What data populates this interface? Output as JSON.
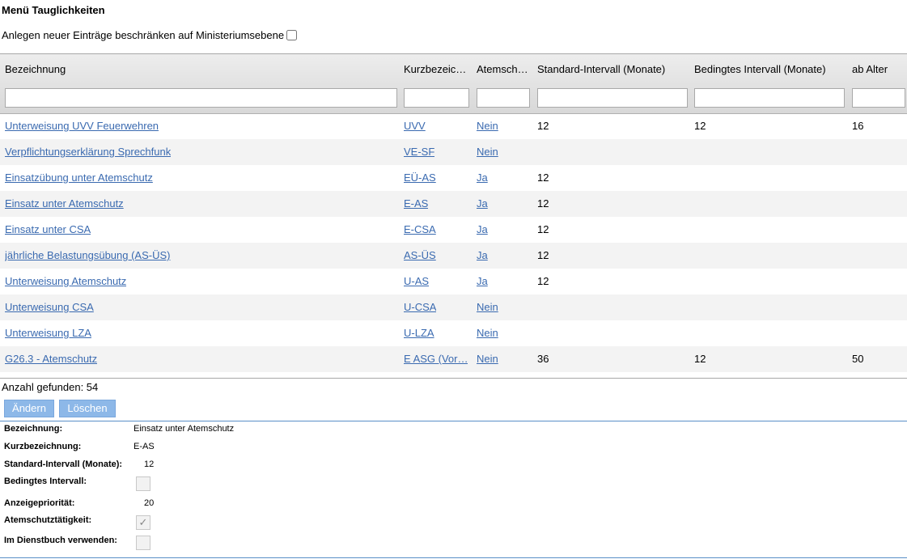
{
  "page_title": "Menü Tauglichkeiten",
  "restrict_label": "Anlegen neuer Einträge beschränken auf Ministeriumsebene",
  "columns": [
    "Bezeichnung",
    "Kurzbezeic…",
    "Atemsch…",
    "Standard-Intervall (Monate)",
    "Bedingtes Intervall (Monate)",
    "ab Alter"
  ],
  "rows": [
    {
      "bezeichnung": "Unterweisung UVV Feuerwehren",
      "kurz": "UVV",
      "atem": "Nein",
      "std": "12",
      "bed": "12",
      "alter": "16"
    },
    {
      "bezeichnung": "Verpflichtungserklärung Sprechfunk",
      "kurz": "VE-SF",
      "atem": "Nein",
      "std": "",
      "bed": "",
      "alter": ""
    },
    {
      "bezeichnung": "Einsatzübung unter Atemschutz",
      "kurz": "EÜ-AS",
      "atem": "Ja",
      "std": "12",
      "bed": "",
      "alter": ""
    },
    {
      "bezeichnung": "Einsatz unter Atemschutz",
      "kurz": "E-AS",
      "atem": "Ja",
      "std": "12",
      "bed": "",
      "alter": ""
    },
    {
      "bezeichnung": "Einsatz unter CSA",
      "kurz": "E-CSA",
      "atem": "Ja",
      "std": "12",
      "bed": "",
      "alter": ""
    },
    {
      "bezeichnung": "jährliche Belastungsübung (AS-ÜS)",
      "kurz": "AS-ÜS",
      "atem": "Ja",
      "std": "12",
      "bed": "",
      "alter": ""
    },
    {
      "bezeichnung": "Unterweisung Atemschutz",
      "kurz": "U-AS",
      "atem": "Ja",
      "std": "12",
      "bed": "",
      "alter": ""
    },
    {
      "bezeichnung": "Unterweisung CSA",
      "kurz": "U-CSA",
      "atem": "Nein",
      "std": "",
      "bed": "",
      "alter": ""
    },
    {
      "bezeichnung": "Unterweisung LZA",
      "kurz": "U-LZA",
      "atem": "Nein",
      "std": "",
      "bed": "",
      "alter": ""
    },
    {
      "bezeichnung": "G26.3 - Atemschutz",
      "kurz": "E ASG (Vor…",
      "atem": "Nein",
      "std": "36",
      "bed": "12",
      "alter": "50"
    }
  ],
  "count_text": "Anzahl gefunden: 54",
  "buttons": {
    "edit": "Ändern",
    "delete": "Löschen"
  },
  "detail": {
    "bezeichnung_label": "Bezeichnung:",
    "bezeichnung_value": "Einsatz unter Atemschutz",
    "kurz_label": "Kurzbezeichnung:",
    "kurz_value": "E-AS",
    "std_label": "Standard-Intervall (Monate):",
    "std_value": "12",
    "bed_label": "Bedingtes Intervall:",
    "bed_checked": false,
    "prio_label": "Anzeigepriorität:",
    "prio_value": "20",
    "atem_label": "Atemschutztätigkeit:",
    "atem_checked": true,
    "dienst_label": "Im Dienstbuch verwenden:",
    "dienst_checked": false
  }
}
